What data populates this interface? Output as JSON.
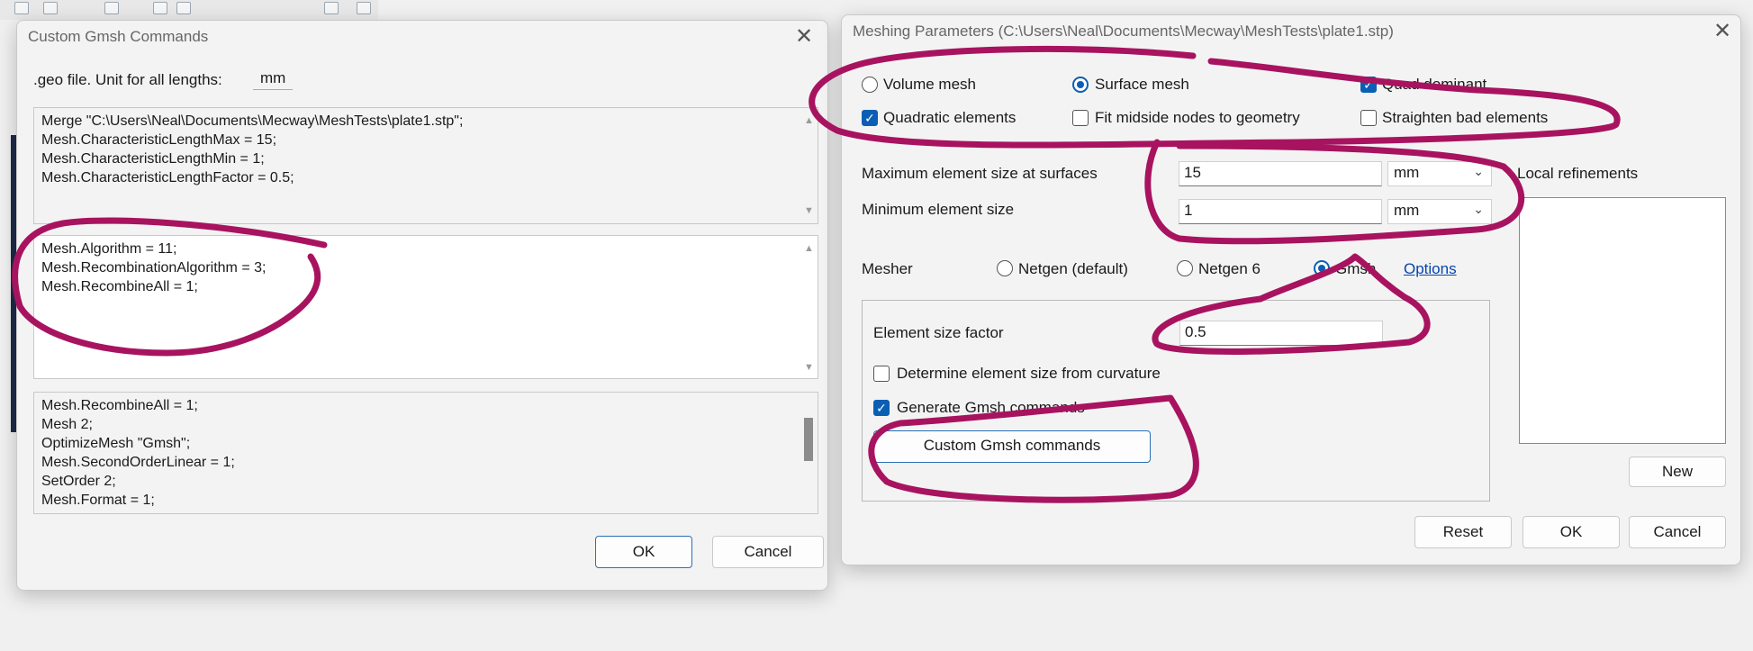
{
  "colors": {
    "annotation": "#a8135f",
    "accent": "#0a5fb4",
    "link": "#0645ad"
  },
  "custom_dialog": {
    "title": "Custom Gmsh Commands",
    "unit_label": ".geo file. Unit for all lengths:",
    "unit_value": "mm",
    "pre_block": "Merge \"C:\\Users\\Neal\\Documents\\Mecway\\MeshTests\\plate1.stp\";\nMesh.CharacteristicLengthMax = 15;\nMesh.CharacteristicLengthMin = 1;\nMesh.CharacteristicLengthFactor = 0.5;",
    "user_block": "Mesh.Algorithm = 11;\nMesh.RecombinationAlgorithm = 3;\nMesh.RecombineAll = 1;",
    "post_block": "Mesh.RecombineAll = 1;\nMesh 2;\nOptimizeMesh \"Gmsh\";\nMesh.SecondOrderLinear = 1;\nSetOrder 2;\nMesh.Format = 1;",
    "ok": "OK",
    "cancel": "Cancel"
  },
  "mesh_dialog": {
    "title": "Meshing Parameters (C:\\Users\\Neal\\Documents\\Mecway\\MeshTests\\plate1.stp)",
    "volume_mesh": "Volume mesh",
    "surface_mesh": "Surface mesh",
    "quad_dominant": "Quad dominant",
    "quadratic": "Quadratic elements",
    "fit_midside": "Fit midside nodes to geometry",
    "straighten": "Straighten bad elements",
    "max_size_label": "Maximum element size at surfaces",
    "max_size_value": "15",
    "max_size_unit": "mm",
    "min_size_label": "Minimum element size",
    "min_size_value": "1",
    "min_size_unit": "mm",
    "local_refinements": "Local refinements",
    "mesher_label": "Mesher",
    "netgen_default": "Netgen (default)",
    "netgen6": "Netgen 6",
    "gmsh": "Gmsh",
    "options": "Options",
    "size_factor_label": "Element size factor",
    "size_factor_value": "0.5",
    "curvature": "Determine element size from curvature",
    "generate_cmds": "Generate Gmsh commands",
    "custom_btn": "Custom Gmsh commands",
    "new": "New",
    "reset": "Reset",
    "ok": "OK",
    "cancel": "Cancel"
  }
}
